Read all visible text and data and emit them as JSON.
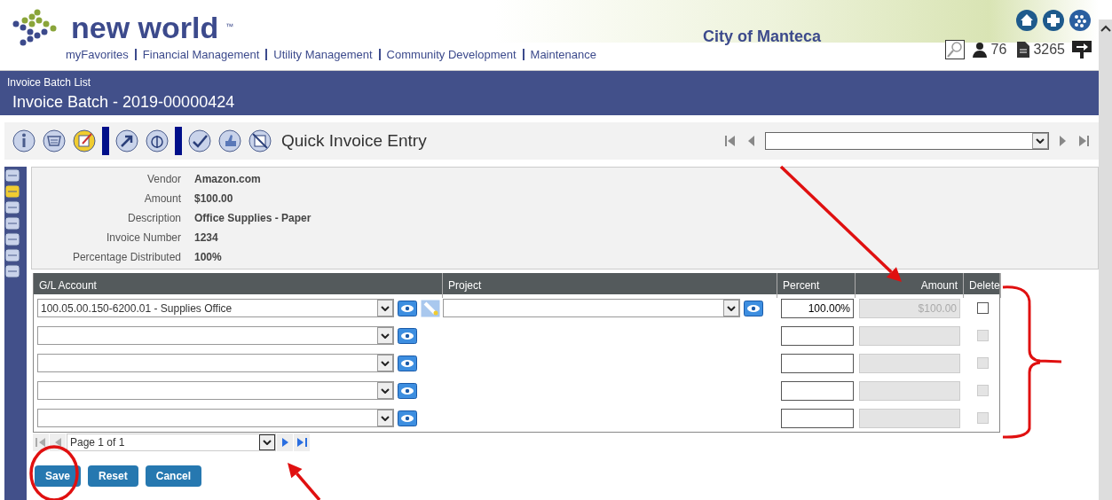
{
  "header": {
    "logo_text": "new world",
    "logo_mark": "™",
    "org": "City of Manteca",
    "nav": [
      "myFavorites",
      "Financial Management",
      "Utility Management",
      "Community Development",
      "Maintenance"
    ],
    "user_count": "76",
    "doc_count": "3265"
  },
  "breadcrumb": "Invoice Batch List",
  "page_title": "Invoice Batch - 2019-00000424",
  "toolbar": {
    "title": "Quick Invoice Entry"
  },
  "details": [
    {
      "label": "Vendor",
      "value": "Amazon.com"
    },
    {
      "label": "Amount",
      "value": "$100.00"
    },
    {
      "label": "Description",
      "value": "Office Supplies - Paper"
    },
    {
      "label": "Invoice Number",
      "value": "1234"
    },
    {
      "label": "Percentage Distributed",
      "value": "100%"
    }
  ],
  "table": {
    "columns": [
      "G/L Account",
      "Project",
      "Percent",
      "Amount",
      "Delete"
    ],
    "rows": [
      {
        "kind": "full",
        "gl_account": "100.05.00.150-6200.01 - Supplies Office",
        "percent": "100.00%",
        "amount": "$100.00",
        "checked": false,
        "disabled": false
      },
      {
        "kind": "basic",
        "checked": false,
        "disabled": true
      },
      {
        "kind": "basic",
        "checked": false,
        "disabled": true
      },
      {
        "kind": "basic",
        "checked": false,
        "disabled": true
      },
      {
        "kind": "basic",
        "checked": false,
        "disabled": true
      }
    ]
  },
  "pager": "Page 1 of 1",
  "buttons": [
    "Save",
    "Reset",
    "Cancel"
  ],
  "annotations": [
    {
      "kind": "arrow"
    },
    {
      "kind": "brace"
    },
    {
      "kind": "circle"
    },
    {
      "kind": "arrow"
    }
  ]
}
